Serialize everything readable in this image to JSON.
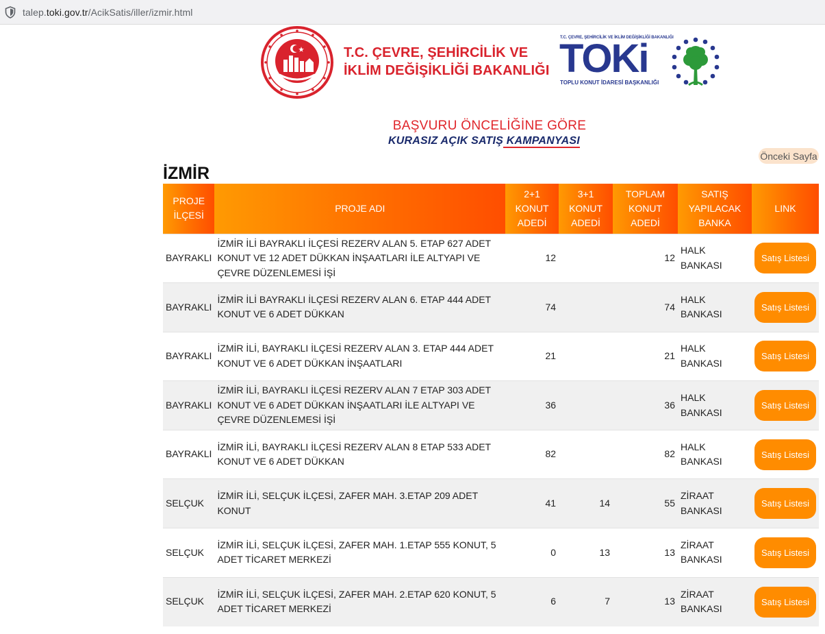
{
  "browser": {
    "url_prefix": "talep.",
    "url_domain": "toki.gov.tr",
    "url_path": "/AcikSatis/iller/izmir.html"
  },
  "header": {
    "ministry_line1": "T.C. ÇEVRE, ŞEHİRCİLİK VE",
    "ministry_line2": "İKLİM DEĞİŞİKLİĞİ BAKANLIĞI",
    "toki_small": "T.C. ÇEVRE, ŞEHİRCİLİK VE İKLİM DEĞİŞİKLİĞİ BAKANLIĞI",
    "toki_big": "TOKi",
    "toki_bottom": "TOPLU KONUT İDARESİ BAŞKANLIĞI"
  },
  "campaign": {
    "line1": "BAŞVURU ÖNCELİĞİNE GÖRE",
    "line2a": "KURASIZ AÇIK SATIŞ",
    "line2b": " KAMPANYASI "
  },
  "prev_page": "Önceki Sayfa",
  "city": "İZMİR",
  "colors": {
    "accent": "#ff8c00",
    "brand_red": "#d9232d",
    "brand_blue": "#28388f"
  },
  "table": {
    "headers": {
      "ilce": "PROJE İLÇESİ",
      "adi": "PROJE ADI",
      "k21": "2+1 KONUT ADEDİ",
      "k31": "3+1 KONUT ADEDİ",
      "toplam": "TOPLAM KONUT ADEDİ",
      "banka": "SATIŞ YAPILACAK BANKA",
      "link": "LINK"
    },
    "rows": [
      {
        "ilce": "BAYRAKLI",
        "adi": "İZMİR İLİ BAYRAKLI İLÇESİ REZERV ALAN 5. ETAP 627 ADET KONUT VE 12 ADET DÜKKAN İNŞAATLARI İLE ALTYAPI VE ÇEVRE DÜZENLEMESİ İŞİ",
        "k21": "12",
        "k31": "",
        "toplam": "12",
        "banka": "HALK BANKASI",
        "link": "Satış Listesi"
      },
      {
        "ilce": "BAYRAKLI",
        "adi": "İZMİR İLİ BAYRAKLI İLÇESİ REZERV ALAN 6. ETAP 444 ADET KONUT VE 6 ADET DÜKKAN",
        "k21": "74",
        "k31": "",
        "toplam": "74",
        "banka": "HALK BANKASI",
        "link": "Satış Listesi"
      },
      {
        "ilce": "BAYRAKLI",
        "adi": "İZMİR İLİ, BAYRAKLI İLÇESİ REZERV ALAN 3. ETAP 444 ADET KONUT VE 6 ADET DÜKKAN İNŞAATLARI",
        "k21": "21",
        "k31": "",
        "toplam": "21",
        "banka": "HALK BANKASI",
        "link": "Satış Listesi"
      },
      {
        "ilce": "BAYRAKLI",
        "adi": "İZMİR İLİ, BAYRAKLI İLÇESİ REZERV ALAN 7 ETAP 303 ADET KONUT VE 6 ADET DÜKKAN İNŞAATLARI İLE ALTYAPI VE ÇEVRE DÜZENLEMESİ İŞİ",
        "k21": "36",
        "k31": "",
        "toplam": "36",
        "banka": "HALK BANKASI",
        "link": "Satış Listesi"
      },
      {
        "ilce": "BAYRAKLI",
        "adi": "İZMİR İLİ, BAYRAKLI İLÇESİ REZERV ALAN 8 ETAP 533 ADET KONUT VE 6 ADET DÜKKAN",
        "k21": "82",
        "k31": "",
        "toplam": "82",
        "banka": "HALK BANKASI",
        "link": "Satış Listesi"
      },
      {
        "ilce": "SELÇUK",
        "adi": "İZMİR İLİ, SELÇUK İLÇESİ, ZAFER MAH. 3.ETAP 209 ADET KONUT",
        "k21": "41",
        "k31": "14",
        "toplam": "55",
        "banka": "ZİRAAT BANKASI",
        "link": "Satış Listesi"
      },
      {
        "ilce": "SELÇUK",
        "adi": "İZMİR İLİ, SELÇUK İLÇESİ, ZAFER MAH. 1.ETAP 555 KONUT, 5 ADET TİCARET MERKEZİ",
        "k21": "0",
        "k31": "13",
        "toplam": "13",
        "banka": "ZİRAAT BANKASI",
        "link": "Satış Listesi"
      },
      {
        "ilce": "SELÇUK",
        "adi": "İZMİR İLİ, SELÇUK İLÇESİ, ZAFER MAH. 2.ETAP 620 KONUT, 5 ADET TİCARET MERKEZİ",
        "k21": "6",
        "k31": "7",
        "toplam": "13",
        "banka": "ZİRAAT BANKASI",
        "link": "Satış Listesi"
      }
    ]
  }
}
